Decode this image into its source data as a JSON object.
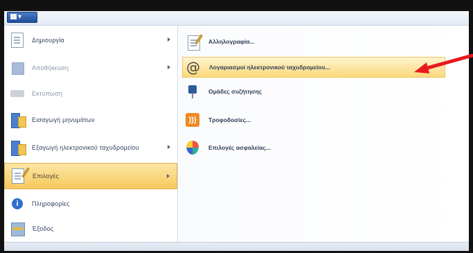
{
  "app_button": {
    "label": "▾"
  },
  "left_menu": {
    "items": [
      {
        "label": "Δημιουργία"
      },
      {
        "label": "Αποθήκευση"
      },
      {
        "label": "Εκτύπωση"
      },
      {
        "label": "Εισαγωγή μηνυμάτων"
      },
      {
        "label": "Εξαγωγή ηλεκτρονικού ταχυδρομείου"
      },
      {
        "label": "Επιλογές"
      },
      {
        "label": "Πληροφορίες"
      },
      {
        "label": "Έξοδος"
      }
    ]
  },
  "submenu": {
    "items": [
      {
        "label": "Αλληλογραφία..."
      },
      {
        "label": "Λογαριασμοί ηλεκτρονικού ταχυδρομείου..."
      },
      {
        "label": "Ομάδες συζήτησης"
      },
      {
        "label": "Τροφοδοσίες..."
      },
      {
        "label": "Επιλογές ασφαλείας..."
      }
    ]
  },
  "colors": {
    "highlight": "#f6c95d",
    "arrow": "#e8191c",
    "app_button": "#1f4f9c"
  }
}
